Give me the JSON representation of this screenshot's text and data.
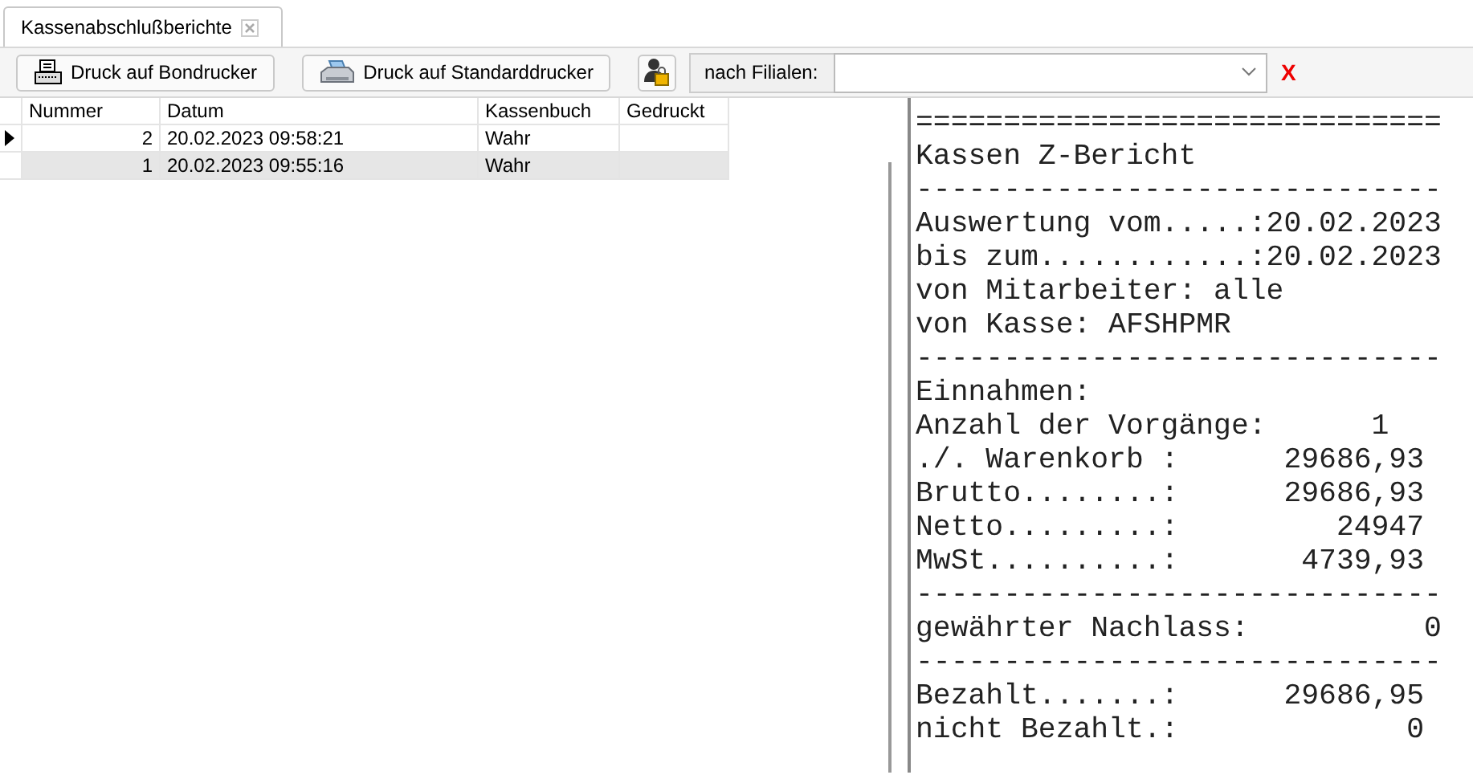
{
  "tabs": [
    {
      "label": "Kassenabschlußberichte",
      "selected": true
    }
  ],
  "toolbar": {
    "buttons": [
      {
        "label": "Druck auf Bondrucker",
        "kind": "receipt"
      },
      {
        "label": "Druck auf Standarddrucker",
        "kind": "printer"
      }
    ],
    "filter": {
      "label": "nach Filialen:",
      "clear": "X"
    }
  },
  "table": {
    "columns": [
      "Nummer",
      "Datum",
      "Kassenbuch",
      "Gedruckt"
    ],
    "rows": [
      {
        "cells": [
          "2",
          "20.02.2023 09:58:21",
          "Wahr",
          ""
        ],
        "current": true,
        "selected": false
      },
      {
        "cells": [
          "1",
          "20.02.2023 09:55:16",
          "Wahr",
          ""
        ],
        "current": false,
        "selected": true
      }
    ]
  },
  "report": {
    "lines": [
      "==============================",
      "Kassen Z-Bericht",
      "------------------------------",
      "Auswertung vom.....:20.02.2023",
      "bis zum............:20.02.2023",
      "von Mitarbeiter: alle",
      "von Kasse: AFSHPMR",
      "------------------------------",
      "Einnahmen:",
      "Anzahl der Vorgänge:      1",
      "./. Warenkorb :      29686,93",
      "Brutto........:      29686,93",
      "Netto.........:         24947",
      "MwSt..........:       4739,93",
      "------------------------------",
      "gewährter Nachlass:          0",
      "------------------------------",
      "Bezahlt.......:      29686,95",
      "nicht Bezahlt.:             0"
    ]
  }
}
